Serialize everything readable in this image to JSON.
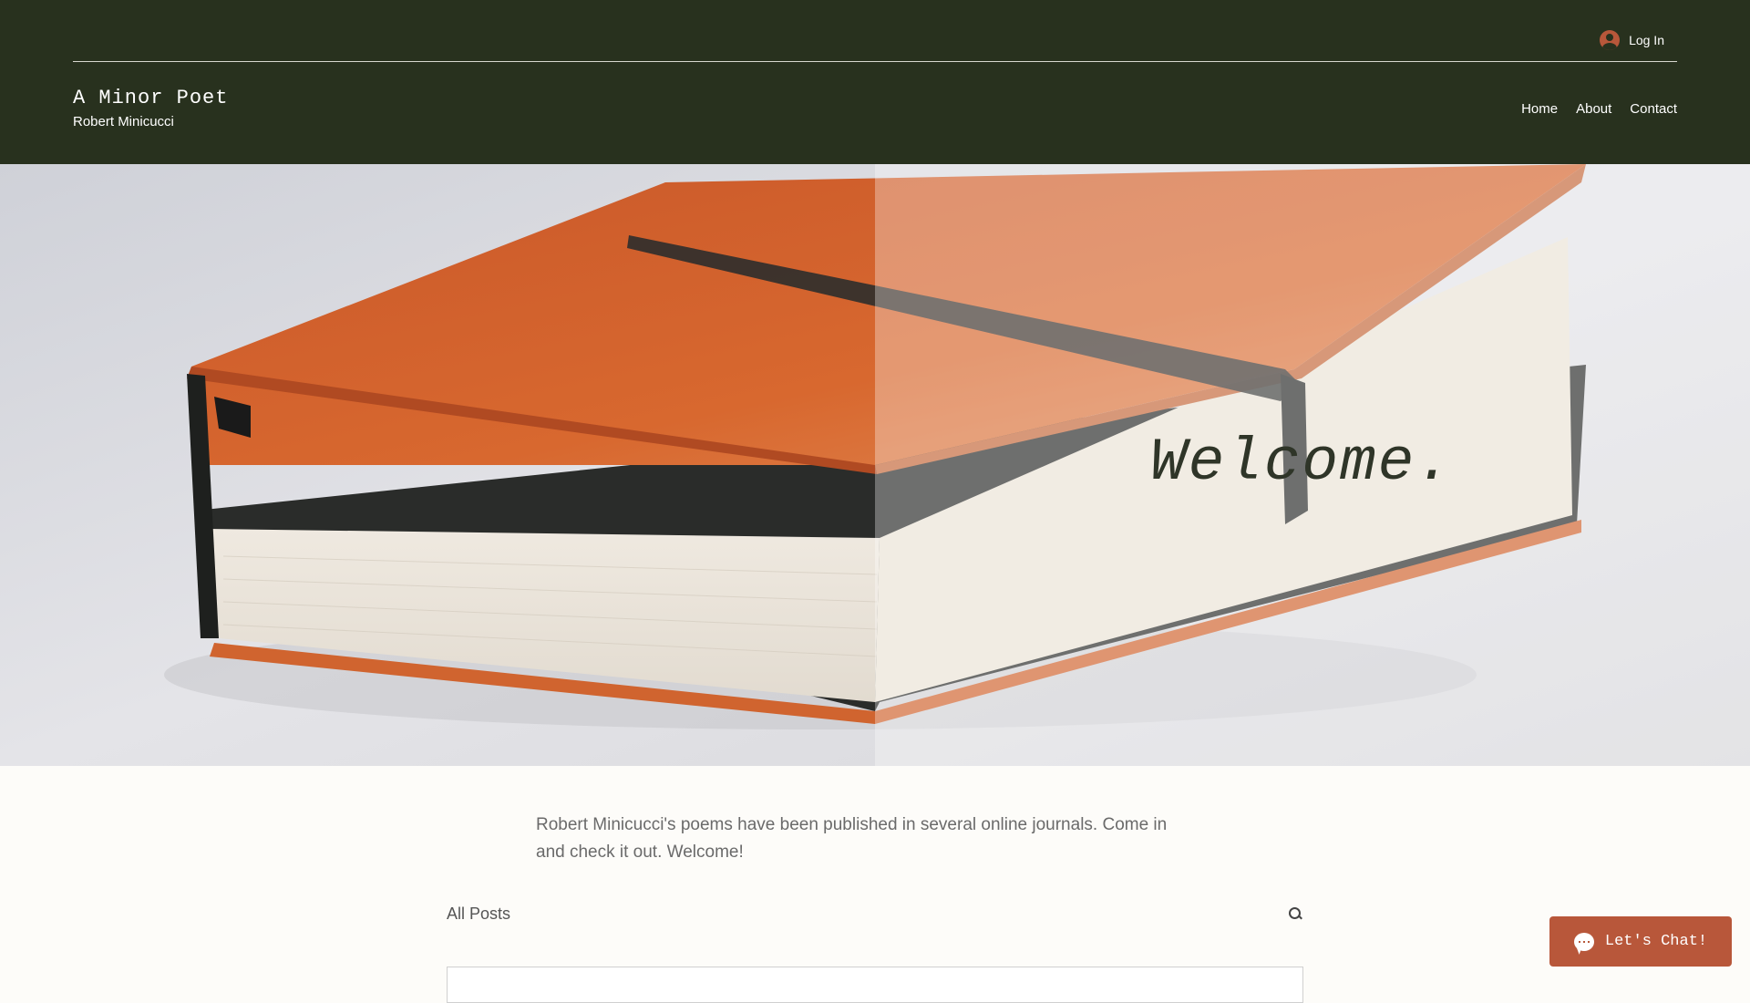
{
  "header": {
    "login_label": "Log In",
    "site_title": "A Minor Poet",
    "site_subtitle": "Robert Minicucci",
    "nav": [
      {
        "label": "Home"
      },
      {
        "label": "About"
      },
      {
        "label": "Contact"
      }
    ]
  },
  "hero": {
    "headline": "Welcome.",
    "image_subject": "orange leather-bound notebook with elastic band"
  },
  "intro": {
    "text": "Robert Minicucci's poems have been published in several online journals. Come in and check it out. Welcome!"
  },
  "blog": {
    "all_posts_label": "All Posts"
  },
  "chat": {
    "label": "Let's Chat!"
  },
  "colors": {
    "header_bg": "#28311e",
    "accent": "#b8573a",
    "page_bg": "#fdfcf9"
  }
}
